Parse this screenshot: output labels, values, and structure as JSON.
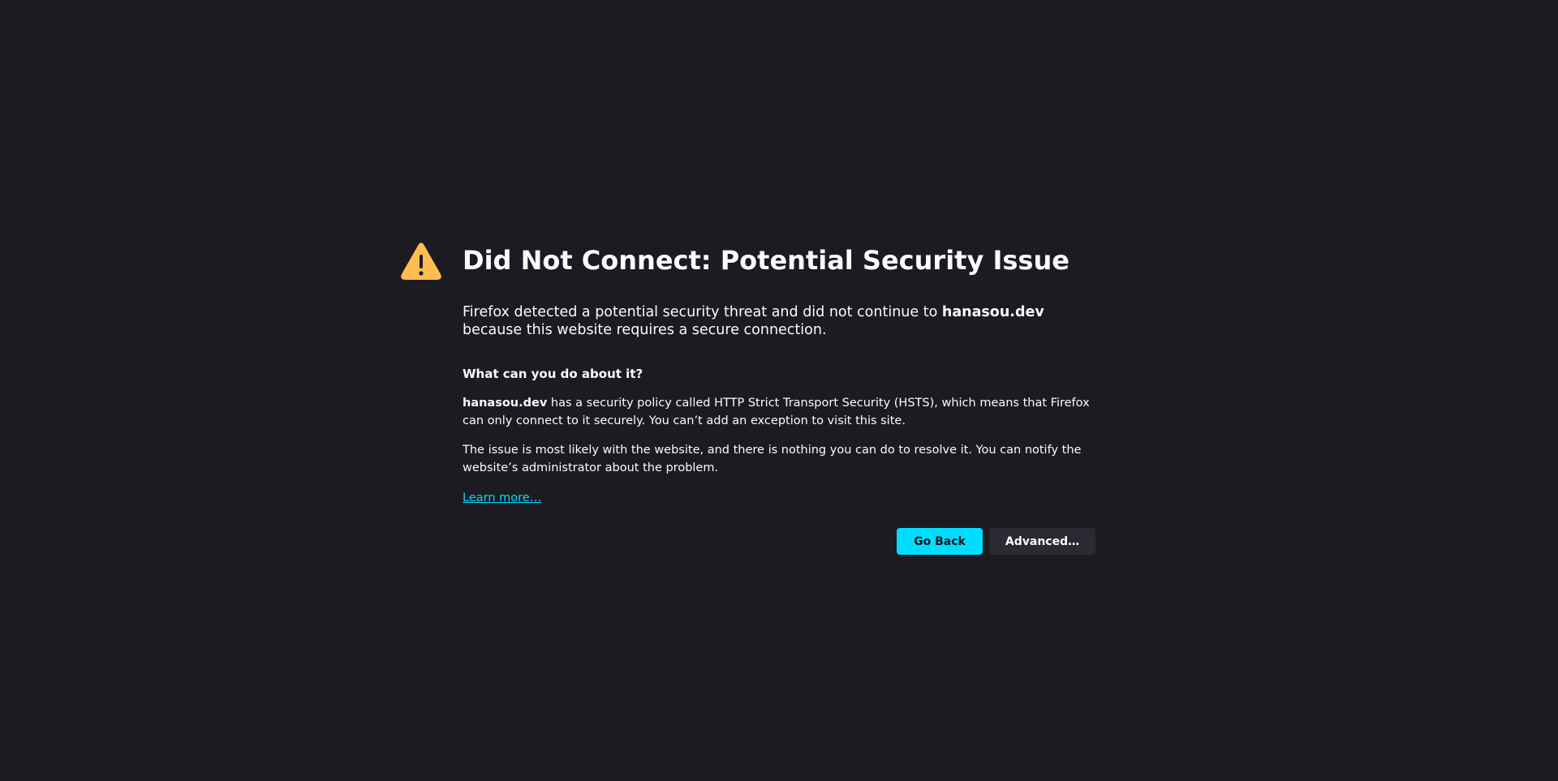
{
  "title": "Did Not Connect: Potential Security Issue",
  "intro": {
    "before": "Firefox detected a potential security threat and did not continue to ",
    "host": "hanasou.dev",
    "after": " because this website requires a secure connection."
  },
  "what_title": "What can you do about it?",
  "hsts_para": {
    "host": "hanasou.dev",
    "text": " has a security policy called HTTP Strict Transport Security (HSTS), which means that Firefox can only connect to it securely. You can’t add an exception to visit this site."
  },
  "issue_para": "The issue is most likely with the website, and there is nothing you can do to resolve it. You can notify the website’s administrator about the problem.",
  "learn_more": "Learn more…",
  "buttons": {
    "go_back": "Go Back",
    "advanced": "Advanced…"
  },
  "icons": {
    "warning": "warning-triangle-icon"
  },
  "colors": {
    "background": "#1c1b22",
    "accent": "#00ddff",
    "warning": "#ffbd4f"
  }
}
